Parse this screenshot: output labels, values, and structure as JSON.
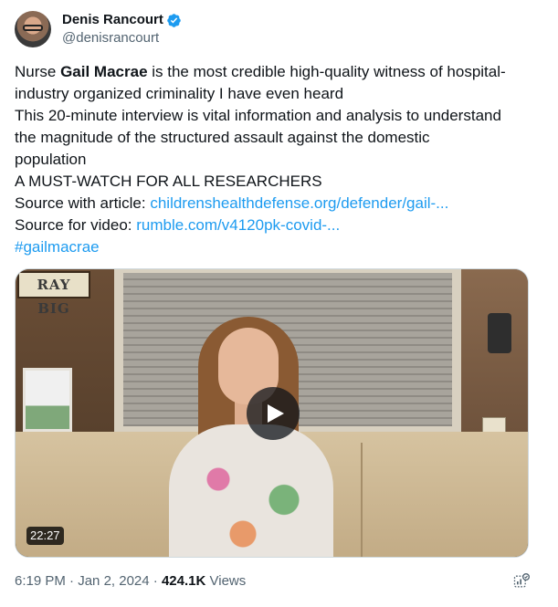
{
  "author": {
    "display_name": "Denis Rancourt",
    "handle": "@denisrancourt",
    "verified_icon": "verified-badge-icon",
    "verified_color": "#1d9bf0"
  },
  "tweet": {
    "line1_pre": "Nurse ",
    "line1_bold": "Gail Macrae",
    "line1_post": " is the most credible high-quality witness of hospital-",
    "line2": "industry organized criminality I have even heard",
    "line3": "This 20-minute interview is vital information and analysis to understand",
    "line4": "the magnitude of the structured assault against the domestic",
    "line5": "population",
    "line6": "A MUST-WATCH FOR ALL RESEARCHERS",
    "source_article_label": "Source with article: ",
    "source_article_link": "childrenshealthdefense.org/defender/gail-...",
    "source_video_label": "Source for video: ",
    "source_video_link": "rumble.com/v4120pk-covid-...",
    "hashtag": "#gailmacrae",
    "link_color": "#1d9bf0"
  },
  "video": {
    "sign_text": "RAY BIG",
    "duration": "22:27",
    "play_icon": "play-icon"
  },
  "meta": {
    "time": "6:19 PM",
    "separator1": " · ",
    "date": "Jan 2, 2024",
    "separator2": " · ",
    "views_count": "424.1K",
    "views_label": " Views",
    "analytics_icon": "analytics-icon"
  }
}
